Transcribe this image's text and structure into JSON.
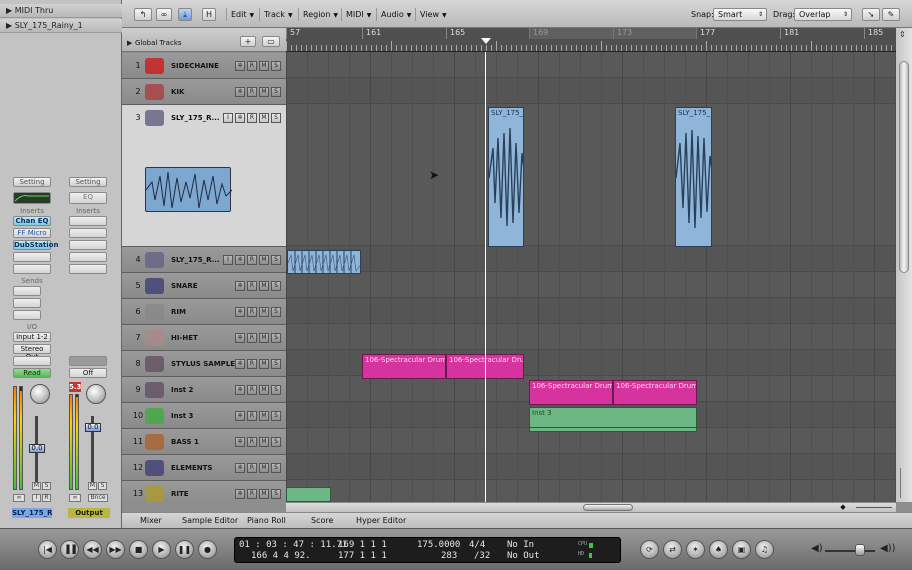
{
  "inspector": {
    "region_rows": [
      "MIDI Thru",
      "SLY_175_Rainy_1"
    ],
    "left_strip": {
      "setting": "Setting",
      "inserts_label": "Inserts",
      "inserts": [
        "Chan EQ",
        "FF Micro",
        "DubStation"
      ],
      "sends_label": "Sends",
      "io_label": "I/O",
      "input": "Input 1-2",
      "output": "Stereo Out",
      "automation": "Read",
      "fader_value": "0.0",
      "mute": "M",
      "solo": "S",
      "input_mon": "I",
      "record": "R",
      "name": "SLY_175_R"
    },
    "right_strip": {
      "setting": "Setting",
      "eq": "EQ",
      "inserts_label": "Inserts",
      "automation": "Off",
      "peak": "5.3",
      "fader_value": "0.0",
      "mute": "M",
      "solo": "S",
      "bnce": "Bnce",
      "name": "Output"
    }
  },
  "toolbar": {
    "menus": [
      "Edit",
      "Track",
      "Region",
      "MIDI",
      "Audio",
      "View"
    ],
    "snap_label": "Snap:",
    "snap_value": "Smart",
    "drag_label": "Drag:",
    "drag_value": "Overlap",
    "h_button": "H"
  },
  "global_tracks": "Global Tracks",
  "ruler": {
    "bars": [
      "57",
      "161",
      "165",
      "169",
      "173",
      "177",
      "181",
      "185"
    ]
  },
  "tracks": [
    {
      "num": "1",
      "name": "SIDECHAINE"
    },
    {
      "num": "2",
      "name": "KIK"
    },
    {
      "num": "3",
      "name": "SLY_175_R..."
    },
    {
      "num": "4",
      "name": "SLY_175_R..."
    },
    {
      "num": "5",
      "name": "SNARE"
    },
    {
      "num": "6",
      "name": "RIM"
    },
    {
      "num": "7",
      "name": "HI-HET"
    },
    {
      "num": "8",
      "name": "STYLUS SAMPLE"
    },
    {
      "num": "9",
      "name": "Inst 2"
    },
    {
      "num": "10",
      "name": "Inst 3"
    },
    {
      "num": "11",
      "name": "BASS 1"
    },
    {
      "num": "12",
      "name": "ELEMENTS"
    },
    {
      "num": "13",
      "name": "RITE"
    }
  ],
  "track_buttons": {
    "m": "M",
    "s": "S",
    "r": "R",
    "i": "I"
  },
  "regions": {
    "audio_a": "SLY_175_",
    "audio_b": "SLY_175_",
    "stylus_1": "106-Spectracular Drum",
    "stylus_2": "106-Spectracular Drum",
    "inst2_1": "106-Spectracular Drum",
    "inst2_2": "106-Spectracular Drum",
    "inst3": "Inst 3"
  },
  "tabs": [
    "Mixer",
    "Sample Editor",
    "Piano Roll",
    "Score",
    "Hyper Editor"
  ],
  "transport": {
    "smpte": "01 : 03 : 47 : 11.71",
    "smpte2": "166   4   4   92.",
    "bars1": "169   1   1     1",
    "bars2": "177   1   1     1",
    "tempo": "175.0000",
    "sig": "4/4",
    "tempo2": "283",
    "div": "/32",
    "in": "No In",
    "out": "No Out",
    "cpu": "CPU",
    "hd": "HD"
  },
  "colors": {
    "midi_region": "#d6339e",
    "audio_region": "#8fb6d9",
    "inst_region": "#6db785",
    "selected_insert": "#7fcbdc",
    "read_button": "#5ab85a"
  }
}
